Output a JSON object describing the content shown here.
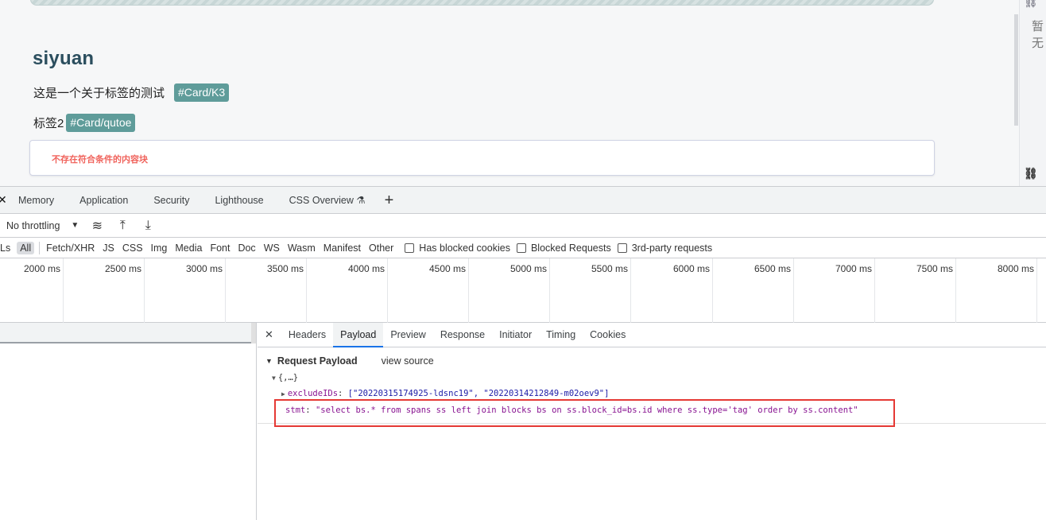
{
  "page": {
    "title": "siyuan",
    "line1_text": "这是一个关于标签的测试",
    "line1_tag": "#Card/K3",
    "line2_text": "标签2",
    "line2_tag": "#Card/qutoe",
    "empty_message": "不存在符合条件的内容块",
    "right_panel_text": "暂无"
  },
  "devtools": {
    "tabs": [
      "Memory",
      "Application",
      "Security",
      "Lighthouse",
      "CSS Overview ⚗"
    ],
    "toolbar": {
      "throttling": "No throttling"
    },
    "filters": {
      "partial": "Ls",
      "all": "All",
      "types": [
        "Fetch/XHR",
        "JS",
        "CSS",
        "Img",
        "Media",
        "Font",
        "Doc",
        "WS",
        "Wasm",
        "Manifest",
        "Other"
      ],
      "checkboxes": [
        "Has blocked cookies",
        "Blocked Requests",
        "3rd-party requests"
      ]
    },
    "timeline_ticks": [
      "2000 ms",
      "2500 ms",
      "3000 ms",
      "3500 ms",
      "4000 ms",
      "4500 ms",
      "5000 ms",
      "5500 ms",
      "6000 ms",
      "6500 ms",
      "7000 ms",
      "7500 ms",
      "8000 ms"
    ],
    "detail_tabs": [
      "Headers",
      "Payload",
      "Preview",
      "Response",
      "Initiator",
      "Timing",
      "Cookies"
    ],
    "active_detail_tab": "Payload",
    "payload": {
      "heading": "Request Payload",
      "view_source": "view source",
      "root": "{,…}",
      "exclude_key": "excludeIDs",
      "exclude_value": "[\"20220315174925-ldsnc19\", \"20220314212849-m02oev9\"]",
      "stmt_key": "stmt",
      "stmt_value": "\"select bs.* from spans ss left join blocks bs on ss.block_id=bs.id where ss.type='tag' order by ss.content\""
    }
  }
}
